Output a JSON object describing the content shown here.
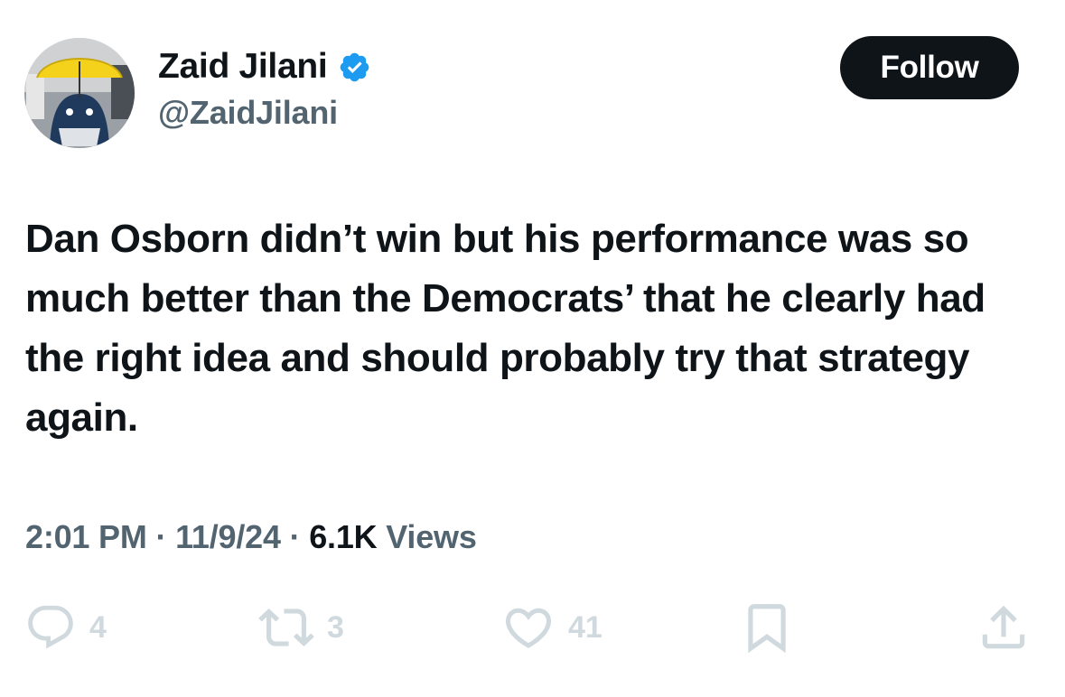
{
  "author": {
    "display_name": "Zaid Jilani",
    "handle": "@ZaidJilani",
    "verified": true
  },
  "follow_label": "Follow",
  "tweet": {
    "text": "Dan Osborn didn’t win but his performance was so much better than the Democrats’ that he clearly had the right idea and should probably try that strategy again."
  },
  "meta": {
    "time": "2:01 PM",
    "separator": " · ",
    "date": "11/9/24",
    "views_count": "6.1K",
    "views_label": " Views"
  },
  "actions": {
    "reply_count": "4",
    "repost_count": "3",
    "like_count": "41"
  },
  "colors": {
    "text_primary": "#0f1419",
    "text_secondary": "#536471",
    "verified_blue": "#1d9bf0",
    "action_icon": "#cfd9de"
  }
}
